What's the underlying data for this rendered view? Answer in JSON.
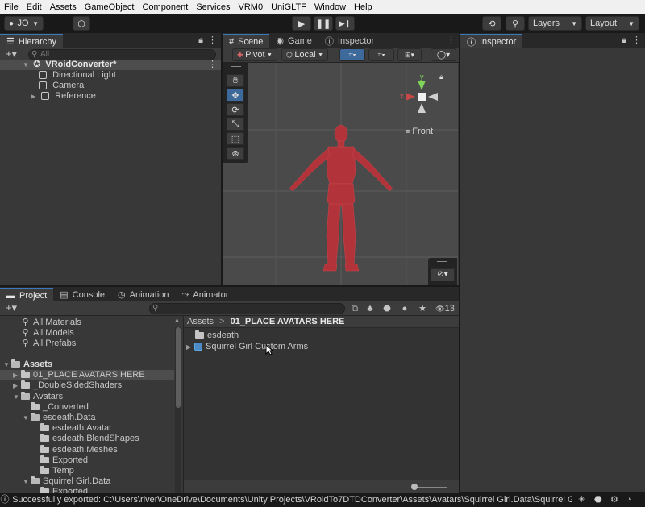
{
  "menu": [
    "File",
    "Edit",
    "Assets",
    "GameObject",
    "Component",
    "Services",
    "VRM0",
    "UniGLTF",
    "Window",
    "Help"
  ],
  "toolbar": {
    "account": "JO",
    "layers": "Layers",
    "layout": "Layout"
  },
  "hierarchy": {
    "tab": "Hierarchy",
    "search_placeholder": "All",
    "scene_name": "VRoidConverter*",
    "items": [
      "Directional Light",
      "Camera",
      "Reference"
    ]
  },
  "scene_tabs": [
    "Scene",
    "Game",
    "Inspector"
  ],
  "scene_toolbar": {
    "pivot": "Pivot",
    "local": "Local"
  },
  "gizmo": {
    "view_label": "Front"
  },
  "inspector": {
    "tab": "Inspector"
  },
  "project_tabs": [
    "Project",
    "Console",
    "Animation",
    "Animator"
  ],
  "project": {
    "visible_count": "13",
    "favorites": [
      "All Materials",
      "All Models",
      "All Prefabs"
    ],
    "tree": [
      {
        "label": "Assets",
        "depth": 0,
        "expanded": true,
        "bold": true
      },
      {
        "label": "01_PLACE AVATARS HERE",
        "depth": 1,
        "expanded": false,
        "selected": true
      },
      {
        "label": "_DoubleSidedShaders",
        "depth": 1,
        "expanded": false
      },
      {
        "label": "Avatars",
        "depth": 1,
        "expanded": true
      },
      {
        "label": "_Converted",
        "depth": 2,
        "expanded": null
      },
      {
        "label": "esdeath.Data",
        "depth": 2,
        "expanded": true
      },
      {
        "label": "esdeath.Avatar",
        "depth": 3,
        "expanded": null
      },
      {
        "label": "esdeath.BlendShapes",
        "depth": 3,
        "expanded": null
      },
      {
        "label": "esdeath.Meshes",
        "depth": 3,
        "expanded": null
      },
      {
        "label": "Exported",
        "depth": 3,
        "expanded": null
      },
      {
        "label": "Temp",
        "depth": 3,
        "expanded": null
      },
      {
        "label": "Squirrel Girl.Data",
        "depth": 2,
        "expanded": true
      },
      {
        "label": "Exported",
        "depth": 3,
        "expanded": null
      }
    ],
    "breadcrumb_root": "Assets",
    "breadcrumb_sep": ">",
    "breadcrumb_current": "01_PLACE AVATARS HERE",
    "contents": [
      {
        "label": "esdeath",
        "type": "folder"
      },
      {
        "label": "Squirrel Girl Custom Arms",
        "type": "prefab"
      }
    ]
  },
  "status": {
    "message": "Successfully exported: C:\\Users\\river\\OneDrive\\Documents\\Unity Projects\\VRoidTo7DTDConverter\\Assets\\Avatars\\Squirrel Girl.Data\\Squirrel Girl C"
  },
  "colors": {
    "accent": "#3a79bb",
    "model": "#c42d35",
    "scene_bg": "#4a4a4a",
    "panel_bg": "#383838"
  }
}
